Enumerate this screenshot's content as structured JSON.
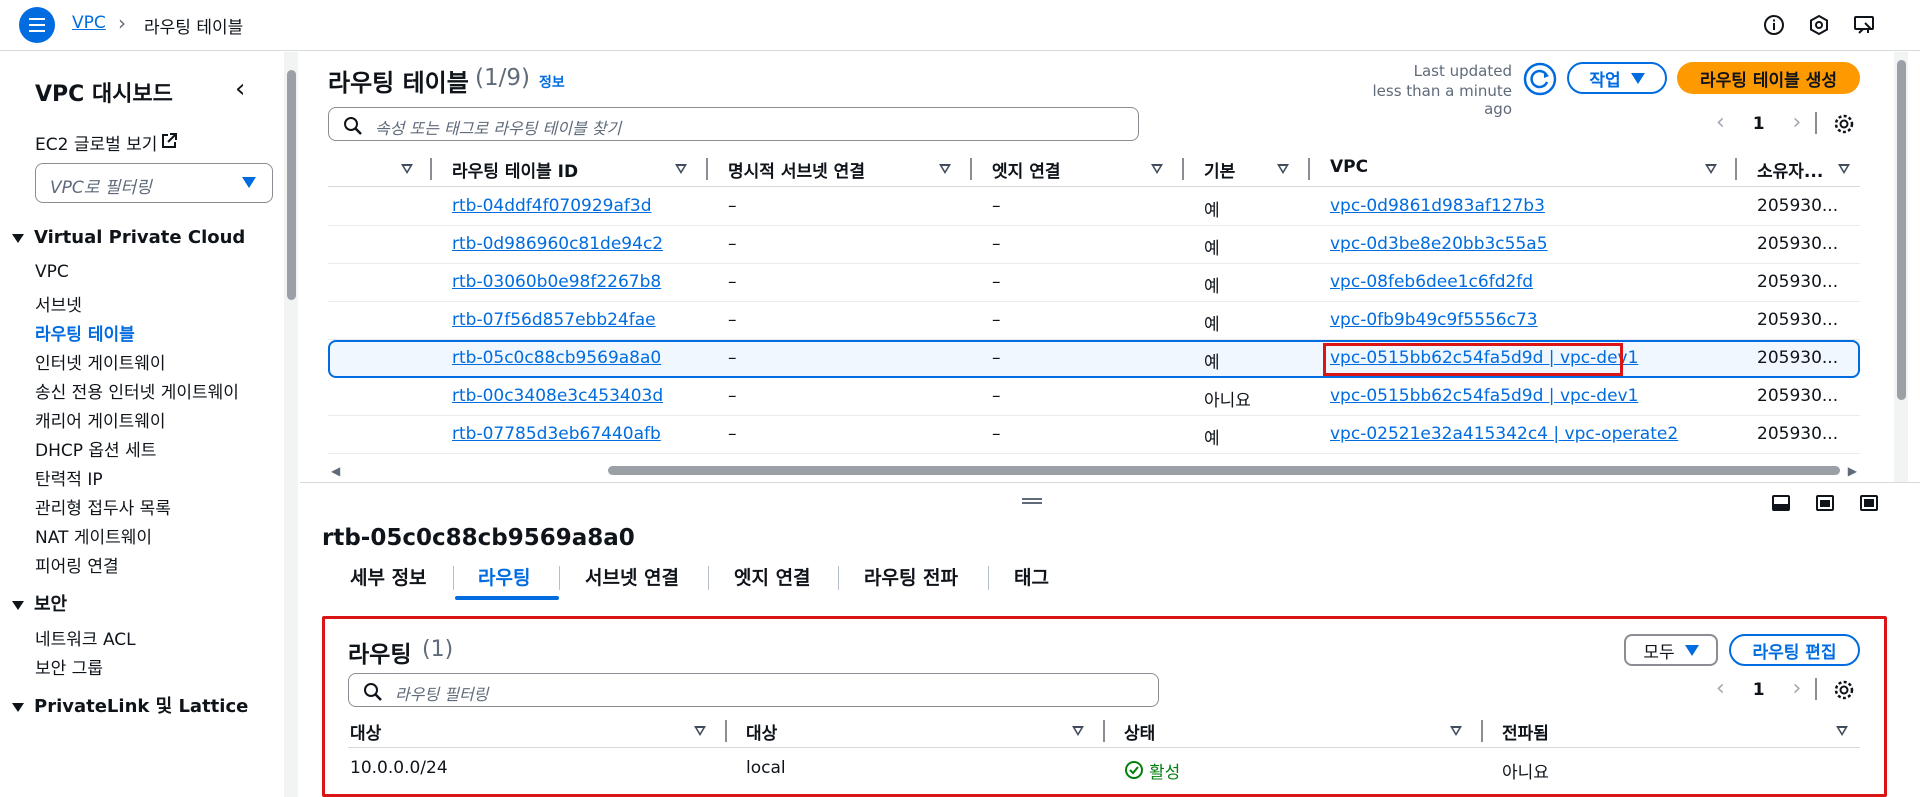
{
  "colors": {
    "accent": "#006ce0",
    "primary_button": "#ff9900",
    "highlight": "#d91515",
    "success": "#037f0c"
  },
  "topbar": {
    "breadcrumb_root": "VPC",
    "breadcrumb_current": "라우팅 테이블",
    "icons": [
      "info-icon",
      "notification-icon",
      "feedback-icon"
    ]
  },
  "sidebar": {
    "title": "VPC 대시보드",
    "ec2_global": "EC2 글로벌 보기",
    "vpc_filter": "VPC로 필터링",
    "sections": [
      {
        "title": "Virtual Private Cloud",
        "items": [
          "VPC",
          "서브넷",
          "라우팅 테이블",
          "인터넷 게이트웨이",
          "송신 전용 인터넷 게이트웨이",
          "캐리어 게이트웨이",
          "DHCP 옵션 세트",
          "탄력적 IP",
          "관리형 접두사 목록",
          "NAT 게이트웨이",
          "피어링 연결"
        ]
      },
      {
        "title": "보안",
        "items": [
          "네트워크 ACL",
          "보안 그룹"
        ]
      },
      {
        "title": "PrivateLink 및 Lattice",
        "items": []
      }
    ],
    "active_item": "라우팅 테이블"
  },
  "route_tables": {
    "title": "라우팅 테이블",
    "count": "(1/9)",
    "info": "정보",
    "last_updated_label": "Last updated",
    "last_updated_value": "less than a minute ago",
    "actions_label": "작업",
    "create_label": "라우팅 테이블 생성",
    "search_placeholder": "속성 또는 태그로 라우팅 테이블 찾기",
    "page": "1",
    "columns": [
      "라우팅 테이블 ID",
      "명시적 서브넷 연결",
      "엣지 연결",
      "기본",
      "VPC",
      "소유자..."
    ],
    "rows": [
      {
        "id": "rtb-04ddf4f070929af3d",
        "subnet": "–",
        "edge": "–",
        "main": "예",
        "vpc": "vpc-0d9861d983af127b3",
        "owner": "205930..."
      },
      {
        "id": "rtb-0d986960c81de94c2",
        "subnet": "–",
        "edge": "–",
        "main": "예",
        "vpc": "vpc-0d3be8e20bb3c55a5",
        "owner": "205930..."
      },
      {
        "id": "rtb-03060b0e98f2267b8",
        "subnet": "–",
        "edge": "–",
        "main": "예",
        "vpc": "vpc-08feb6dee1c6fd2fd",
        "owner": "205930..."
      },
      {
        "id": "rtb-07f56d857ebb24fae",
        "subnet": "–",
        "edge": "–",
        "main": "예",
        "vpc": "vpc-0fb9b49c9f5556c73",
        "owner": "205930..."
      },
      {
        "id": "rtb-05c0c88cb9569a8a0",
        "subnet": "–",
        "edge": "–",
        "main": "예",
        "vpc": "vpc-0515bb62c54fa5d9d | vpc-dev1",
        "owner": "205930...",
        "selected": true
      },
      {
        "id": "rtb-00c3408e3c453403d",
        "subnet": "–",
        "edge": "–",
        "main": "아니요",
        "vpc": "vpc-0515bb62c54fa5d9d | vpc-dev1",
        "owner": "205930..."
      },
      {
        "id": "rtb-07785d3eb67440afb",
        "subnet": "–",
        "edge": "–",
        "main": "예",
        "vpc": "vpc-02521e32a415342c4 | vpc-operate2",
        "owner": "205930..."
      }
    ]
  },
  "detail": {
    "title": "rtb-05c0c88cb9569a8a0",
    "tabs": [
      "세부 정보",
      "라우팅",
      "서브넷 연결",
      "엣지 연결",
      "라우팅 전파",
      "태그"
    ],
    "active_tab": "라우팅",
    "routes": {
      "title": "라우팅",
      "count": "(1)",
      "filter_value": "모두",
      "edit_label": "라우팅 편집",
      "search_placeholder": "라우팅 필터링",
      "page": "1",
      "columns": [
        "대상",
        "대상",
        "상태",
        "전파됨"
      ],
      "rows": [
        {
          "destination": "10.0.0.0/24",
          "target": "local",
          "status": "활성",
          "propagated": "아니요"
        }
      ]
    }
  }
}
